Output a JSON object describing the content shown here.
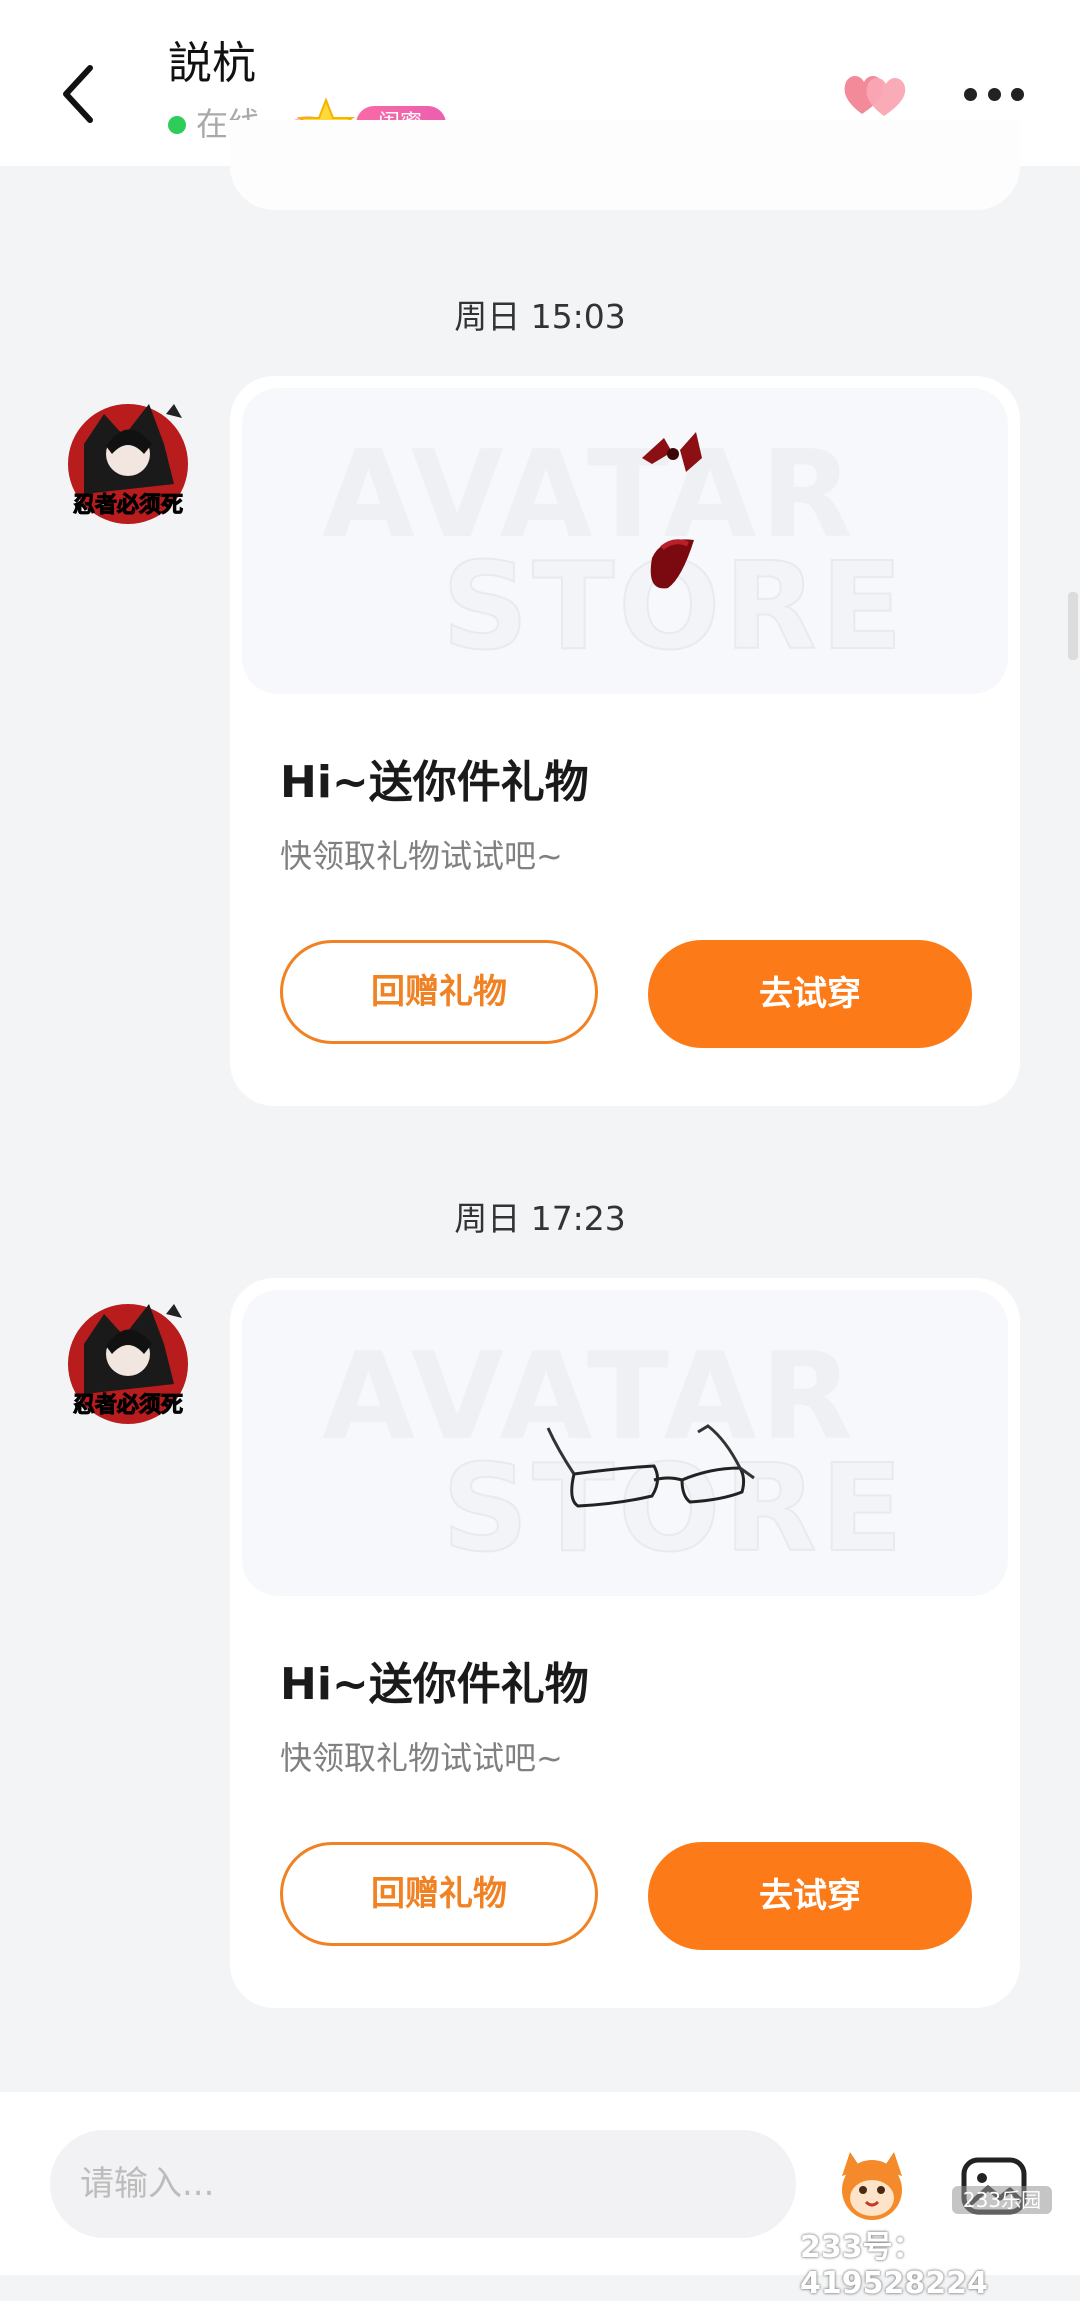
{
  "header": {
    "title": "説杭",
    "status": "在线",
    "relationship_badge": "闺蜜"
  },
  "messages": [
    {
      "time": "周日 15:03",
      "gift": "hairpin-bow",
      "watermark_line1": "AVATAR",
      "watermark_line2": "STORE",
      "title": "Hi~送你件礼物",
      "subtitle": "快领取礼物试试吧~",
      "return_gift_label": "回赠礼物",
      "try_on_label": "去试穿"
    },
    {
      "time": "周日 17:23",
      "gift": "glasses",
      "watermark_line1": "AVATAR",
      "watermark_line2": "STORE",
      "title": "Hi~送你件礼物",
      "subtitle": "快领取礼物试试吧~",
      "return_gift_label": "回赠礼物",
      "try_on_label": "去试穿"
    }
  ],
  "input": {
    "placeholder": "请输入..."
  },
  "watermark": {
    "id_text": "233号：419528224",
    "logo_text": "233乐园"
  },
  "colors": {
    "accent": "#fc7a17",
    "online": "#2fcc5a",
    "badge": "#ef62ad"
  }
}
